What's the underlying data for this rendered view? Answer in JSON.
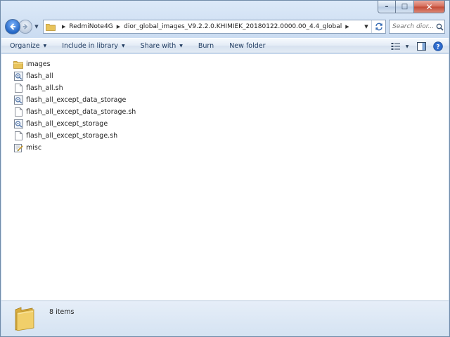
{
  "window": {
    "minimize_glyph": "–",
    "maximize_glyph": "□",
    "close_glyph": "✕"
  },
  "address": {
    "breadcrumbs": [
      "RedmiNote4G",
      "dior_global_images_V9.2.2.0.KHIMIEK_20180122.0000.00_4.4_global"
    ],
    "search_placeholder": "Search dior..."
  },
  "toolbar": {
    "organize": "Organize",
    "include_in_library": "Include in library",
    "share_with": "Share with",
    "burn": "Burn",
    "new_folder": "New folder"
  },
  "files": [
    {
      "name": "images",
      "icon": "folder-icon"
    },
    {
      "name": "flash_all",
      "icon": "batch-file-icon"
    },
    {
      "name": "flash_all.sh",
      "icon": "document-icon"
    },
    {
      "name": "flash_all_except_data_storage",
      "icon": "batch-file-icon"
    },
    {
      "name": "flash_all_except_data_storage.sh",
      "icon": "document-icon"
    },
    {
      "name": "flash_all_except_storage",
      "icon": "batch-file-icon"
    },
    {
      "name": "flash_all_except_storage.sh",
      "icon": "document-icon"
    },
    {
      "name": "misc",
      "icon": "text-edit-file-icon"
    }
  ],
  "status": {
    "item_count": "8 items"
  },
  "colors": {
    "folder": "#e8c35a",
    "accent": "#2466c4"
  }
}
